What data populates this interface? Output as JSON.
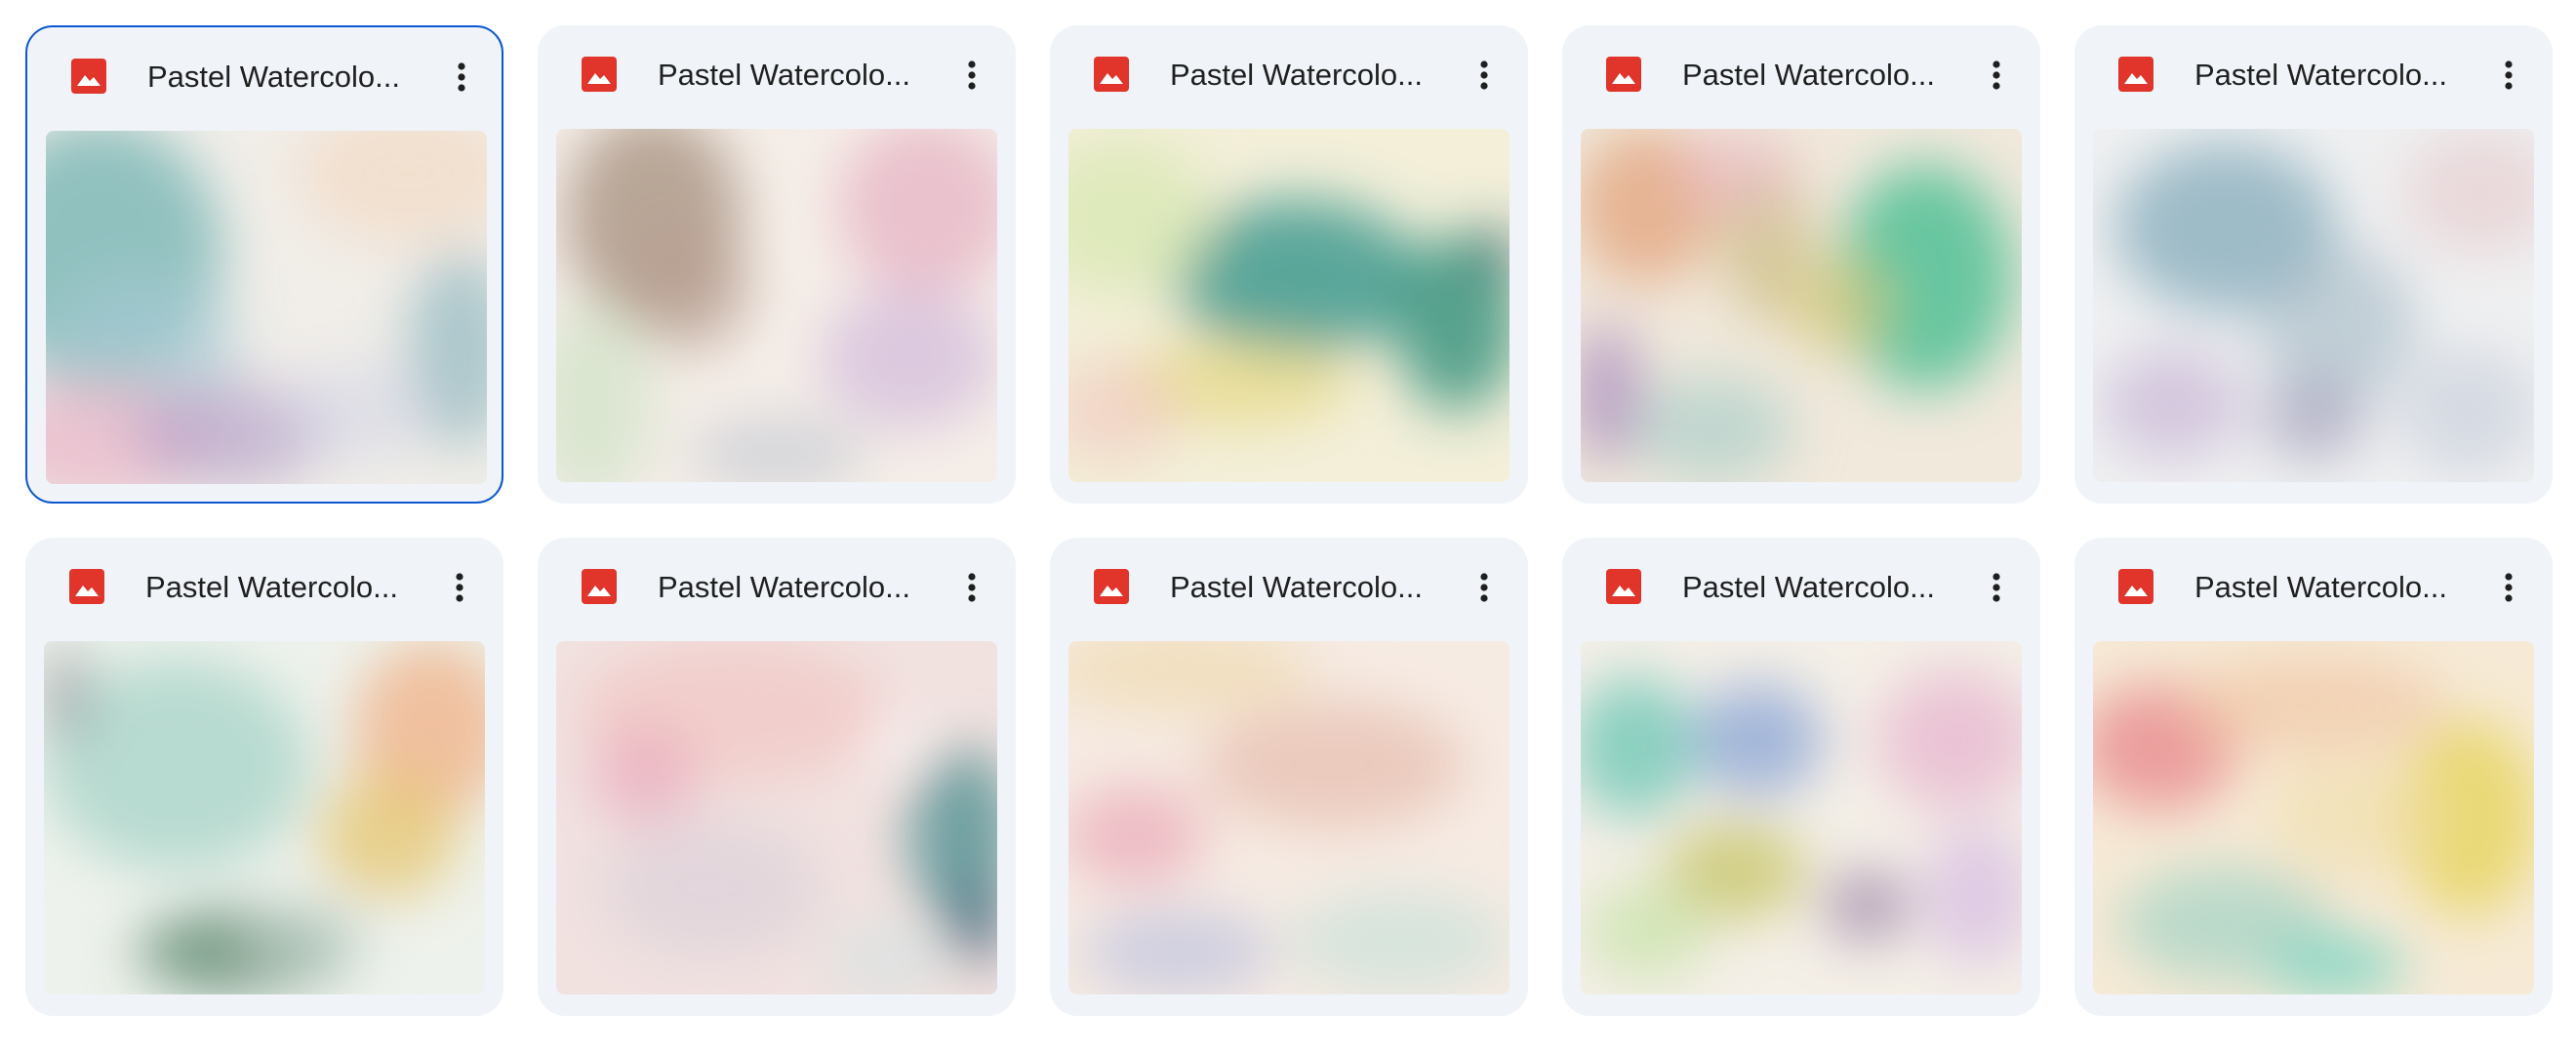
{
  "files": [
    {
      "name": "Pastel Watercolo...",
      "icon": "image-file-icon",
      "selected": true,
      "thumb": {
        "base": "#f1eee9",
        "blobs": [
          [
            "#7fb8b7",
            0.12,
            0.35,
            0.28,
            0.38,
            0.85
          ],
          [
            "#a9c9d6",
            0.22,
            0.62,
            0.22,
            0.22,
            0.6
          ],
          [
            "#f3dcc8",
            0.82,
            0.12,
            0.25,
            0.2,
            0.8
          ],
          [
            "#e9b7c8",
            0.12,
            0.88,
            0.26,
            0.18,
            0.75
          ],
          [
            "#b6a3c9",
            0.42,
            0.86,
            0.22,
            0.15,
            0.7
          ],
          [
            "#8fb7bf",
            0.94,
            0.62,
            0.12,
            0.28,
            0.7
          ],
          [
            "#d3d6e6",
            0.7,
            0.8,
            0.18,
            0.14,
            0.6
          ]
        ]
      }
    },
    {
      "name": "Pastel Watercolo...",
      "icon": "image-file-icon",
      "selected": false,
      "thumb": {
        "base": "#f5eee8",
        "blobs": [
          [
            "#a99483",
            0.22,
            0.25,
            0.2,
            0.3,
            0.8
          ],
          [
            "#b99f93",
            0.3,
            0.45,
            0.14,
            0.18,
            0.7
          ],
          [
            "#e7b7c6",
            0.84,
            0.22,
            0.2,
            0.25,
            0.8
          ],
          [
            "#d2b9dc",
            0.8,
            0.65,
            0.2,
            0.2,
            0.7
          ],
          [
            "#cfe3c6",
            0.08,
            0.78,
            0.14,
            0.28,
            0.7
          ],
          [
            "#bcc3ce",
            0.5,
            0.92,
            0.2,
            0.1,
            0.6
          ]
        ]
      }
    },
    {
      "name": "Pastel Watercolo...",
      "icon": "image-file-icon",
      "selected": false,
      "thumb": {
        "base": "#f3efd9",
        "blobs": [
          [
            "#3e9a8f",
            0.52,
            0.42,
            0.28,
            0.22,
            0.85
          ],
          [
            "#2f8e7b",
            0.88,
            0.55,
            0.14,
            0.25,
            0.8
          ],
          [
            "#d9e8b4",
            0.12,
            0.25,
            0.2,
            0.22,
            0.8
          ],
          [
            "#e6d77f",
            0.38,
            0.72,
            0.26,
            0.12,
            0.7
          ],
          [
            "#f1c6c0",
            0.1,
            0.8,
            0.15,
            0.15,
            0.6
          ],
          [
            "#274a5f",
            0.97,
            0.35,
            0.04,
            0.08,
            0.8
          ]
        ]
      }
    },
    {
      "name": "Pastel Watercolo...",
      "icon": "image-file-icon",
      "selected": false,
      "thumb": {
        "base": "#f1e9dc",
        "blobs": [
          [
            "#4fbf95",
            0.78,
            0.42,
            0.2,
            0.32,
            0.85
          ],
          [
            "#e4a67f",
            0.15,
            0.22,
            0.16,
            0.22,
            0.8
          ],
          [
            "#c9b980",
            0.42,
            0.32,
            0.1,
            0.22,
            0.7
          ],
          [
            "#d6c77a",
            0.58,
            0.5,
            0.12,
            0.14,
            0.7
          ],
          [
            "#a98bbd",
            0.06,
            0.75,
            0.08,
            0.2,
            0.75
          ],
          [
            "#9fc9c7",
            0.3,
            0.85,
            0.18,
            0.15,
            0.6
          ],
          [
            "#e9b6c1",
            0.35,
            0.12,
            0.14,
            0.12,
            0.6
          ]
        ]
      }
    },
    {
      "name": "Pastel Watercolo...",
      "icon": "image-file-icon",
      "selected": false,
      "thumb": {
        "base": "#eff0f1",
        "blobs": [
          [
            "#8fb3c1",
            0.3,
            0.28,
            0.25,
            0.24,
            0.85
          ],
          [
            "#a1b7c4",
            0.55,
            0.55,
            0.18,
            0.22,
            0.6
          ],
          [
            "#e6c9cc",
            0.88,
            0.18,
            0.18,
            0.18,
            0.6
          ],
          [
            "#c9b7d6",
            0.18,
            0.78,
            0.16,
            0.16,
            0.7
          ],
          [
            "#9e9bb9",
            0.5,
            0.82,
            0.12,
            0.12,
            0.65
          ],
          [
            "#c5cbd8",
            0.85,
            0.8,
            0.16,
            0.18,
            0.6
          ]
        ]
      }
    },
    {
      "name": "Pastel Watercolo...",
      "icon": "image-file-icon",
      "selected": false,
      "thumb": {
        "base": "#eef2ec",
        "blobs": [
          [
            "#a6d3c7",
            0.3,
            0.35,
            0.3,
            0.3,
            0.75
          ],
          [
            "#f0b48c",
            0.88,
            0.25,
            0.18,
            0.25,
            0.8
          ],
          [
            "#e6c56f",
            0.78,
            0.55,
            0.16,
            0.18,
            0.75
          ],
          [
            "#4f7f63",
            0.45,
            0.88,
            0.24,
            0.12,
            0.75
          ],
          [
            "#8c8b94",
            0.05,
            0.15,
            0.05,
            0.14,
            0.7
          ],
          [
            "#c8d7d0",
            0.6,
            0.85,
            0.14,
            0.12,
            0.6
          ]
        ]
      }
    },
    {
      "name": "Pastel Watercolo...",
      "icon": "image-file-icon",
      "selected": false,
      "thumb": {
        "base": "#f1e2e0",
        "blobs": [
          [
            "#f1c9c5",
            0.4,
            0.2,
            0.35,
            0.2,
            0.8
          ],
          [
            "#e9a9bd",
            0.2,
            0.38,
            0.12,
            0.14,
            0.7
          ],
          [
            "#d9cfd8",
            0.35,
            0.7,
            0.25,
            0.2,
            0.6
          ],
          [
            "#4f8f91",
            0.92,
            0.55,
            0.12,
            0.25,
            0.8
          ],
          [
            "#2f5872",
            0.95,
            0.8,
            0.06,
            0.12,
            0.8
          ],
          [
            "#cfe3e2",
            0.75,
            0.9,
            0.14,
            0.1,
            0.6
          ],
          [
            "#ffffff",
            0.78,
            0.3,
            0.06,
            0.06,
            0.9
          ]
        ]
      }
    },
    {
      "name": "Pastel Watercolo...",
      "icon": "image-file-icon",
      "selected": false,
      "thumb": {
        "base": "#f6ebe3",
        "blobs": [
          [
            "#f0dcb4",
            0.25,
            0.08,
            0.3,
            0.12,
            0.8
          ],
          [
            "#e8c2b4",
            0.6,
            0.35,
            0.3,
            0.18,
            0.8
          ],
          [
            "#e9a7b6",
            0.15,
            0.55,
            0.16,
            0.14,
            0.7
          ],
          [
            "#b9bedf",
            0.25,
            0.88,
            0.22,
            0.12,
            0.65
          ],
          [
            "#c7e1d8",
            0.75,
            0.85,
            0.25,
            0.14,
            0.7
          ]
        ]
      }
    },
    {
      "name": "Pastel Watercolo...",
      "icon": "image-file-icon",
      "selected": false,
      "thumb": {
        "base": "#f4efe7",
        "blobs": [
          [
            "#6fc8b6",
            0.12,
            0.3,
            0.14,
            0.2,
            0.8
          ],
          [
            "#8da8d6",
            0.4,
            0.28,
            0.15,
            0.16,
            0.8
          ],
          [
            "#e7b6cf",
            0.85,
            0.28,
            0.18,
            0.2,
            0.75
          ],
          [
            "#c8c66b",
            0.35,
            0.65,
            0.16,
            0.14,
            0.8
          ],
          [
            "#9c84a7",
            0.65,
            0.75,
            0.1,
            0.1,
            0.75
          ],
          [
            "#c6e3a5",
            0.15,
            0.82,
            0.14,
            0.14,
            0.7
          ],
          [
            "#d6b9e3",
            0.9,
            0.72,
            0.12,
            0.2,
            0.7
          ]
        ]
      }
    },
    {
      "name": "Pastel Watercolo...",
      "icon": "image-file-icon",
      "selected": false,
      "thumb": {
        "base": "#f6ead6",
        "blobs": [
          [
            "#e98b8f",
            0.15,
            0.3,
            0.18,
            0.18,
            0.8
          ],
          [
            "#f1c7a6",
            0.5,
            0.18,
            0.3,
            0.14,
            0.7
          ],
          [
            "#e7d55c",
            0.85,
            0.5,
            0.16,
            0.28,
            0.8
          ],
          [
            "#9fd1c4",
            0.3,
            0.8,
            0.24,
            0.16,
            0.7
          ],
          [
            "#6cd2c2",
            0.55,
            0.92,
            0.16,
            0.08,
            0.8
          ],
          [
            "#f0dda6",
            0.6,
            0.5,
            0.2,
            0.16,
            0.6
          ]
        ]
      }
    }
  ],
  "more_button_label": "More actions"
}
